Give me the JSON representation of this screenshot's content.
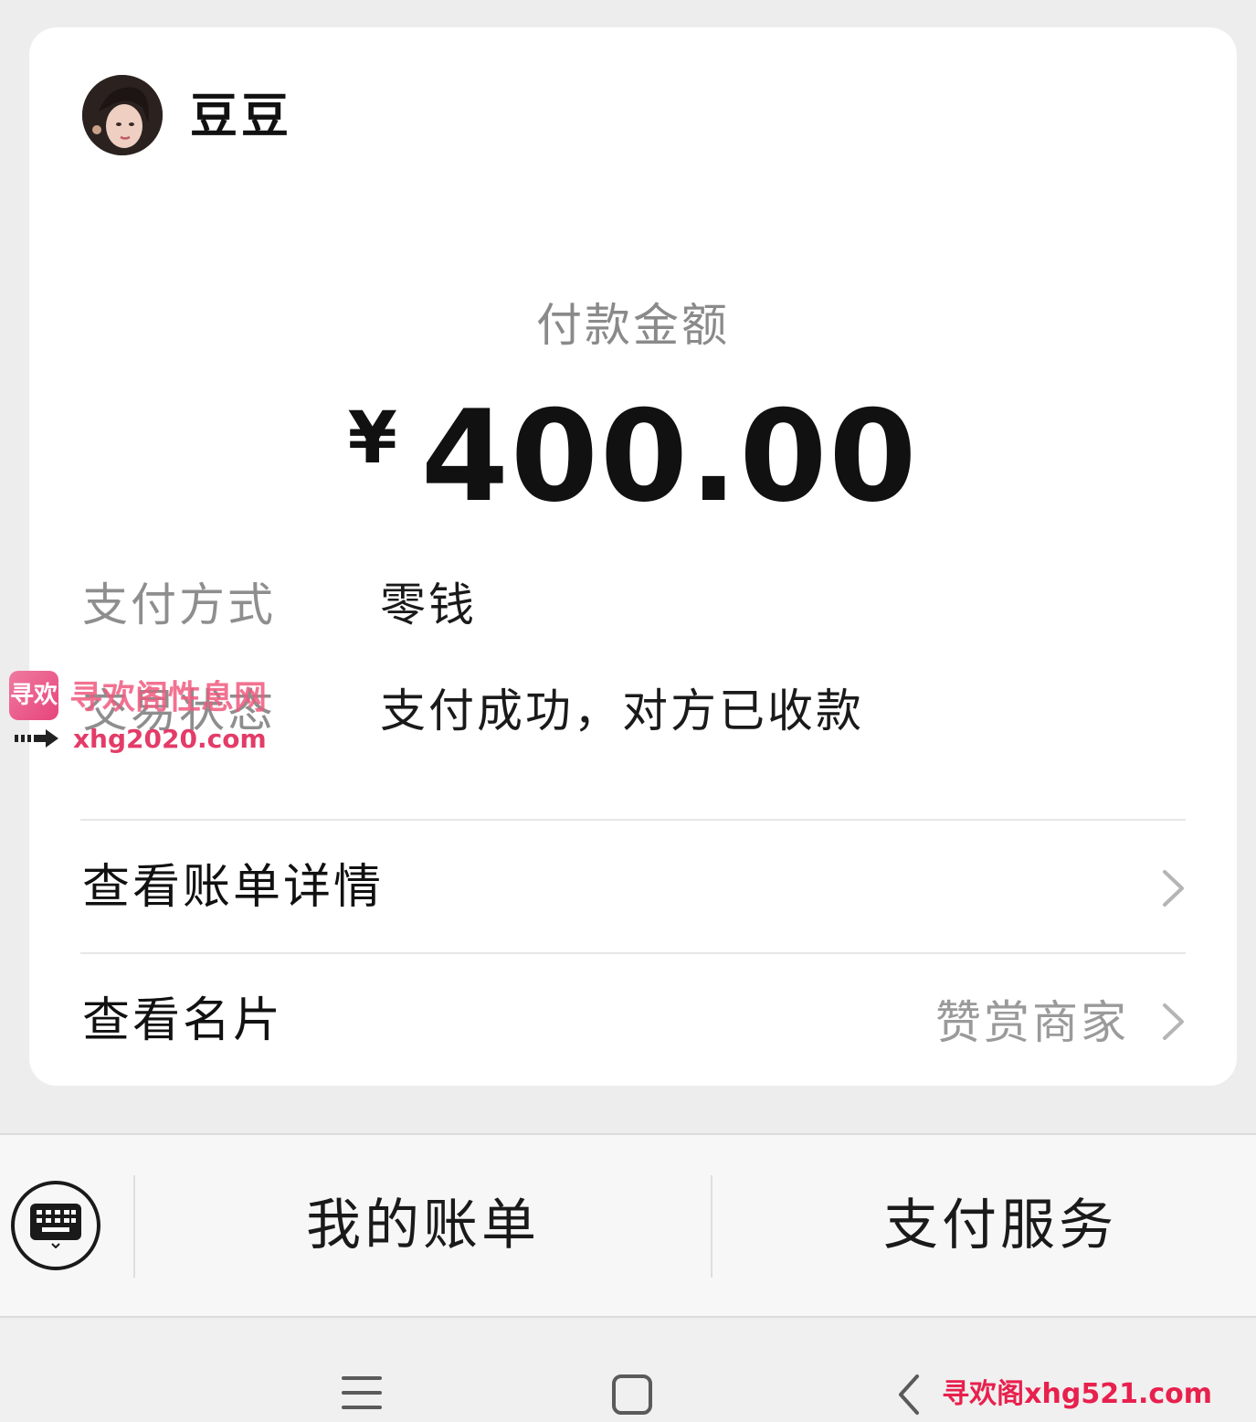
{
  "payee": {
    "name": "豆豆"
  },
  "payment": {
    "amount_label": "付款金额",
    "currency_symbol": "¥",
    "amount": "400.00"
  },
  "details": [
    {
      "label": "支付方式",
      "value": "零钱"
    },
    {
      "label": "交易状态",
      "value": "支付成功，对方已收款"
    }
  ],
  "links": {
    "bill_details": "查看账单详情",
    "business_card": "查看名片",
    "reward_merchant": "赞赏商家"
  },
  "bottom_bar": {
    "my_bills": "我的账单",
    "pay_services": "支付服务"
  },
  "watermarks": {
    "logo_text": "寻欢",
    "overlay_title": "寻欢阁性息网",
    "overlay_url": "xhg2020.com",
    "corner": "寻欢阁xhg521.com"
  },
  "icons": {
    "avatar": "avatar",
    "chevron": "chevron-right-icon",
    "keyboard": "keyboard-icon",
    "nav_menu": "menu-icon",
    "nav_home": "home-square-icon",
    "nav_back": "back-chevron-icon"
  },
  "colors": {
    "background": "#ededed",
    "card": "#ffffff",
    "label_gray": "#8e8e8e",
    "watermark_pink": "#e33c68"
  }
}
